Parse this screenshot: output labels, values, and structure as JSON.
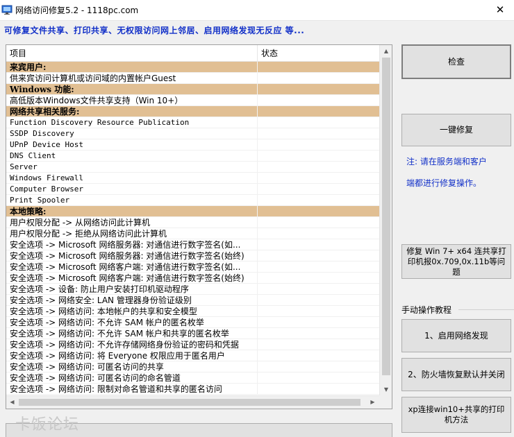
{
  "window": {
    "title": "网络访问修复5.2 - 1118pc.com",
    "close_glyph": "✕"
  },
  "subtitle": "可修复文件共享、打印共享、无权限访问网上邻居、启用网络发现无反应  等...",
  "list": {
    "columns": [
      "项目",
      "状态"
    ],
    "rows": [
      {
        "type": "section",
        "text": "来宾用户:"
      },
      {
        "type": "item",
        "text": "供来宾访问计算机或访问域的内置帐户Guest"
      },
      {
        "type": "section",
        "text": "Windows 功能:"
      },
      {
        "type": "item",
        "text": "高低版本Windows文件共享支持（Win 10+）"
      },
      {
        "type": "section",
        "text": "网络共享相关服务:"
      },
      {
        "type": "item",
        "text": "Function Discovery Resource Publication",
        "mono": true
      },
      {
        "type": "item",
        "text": "SSDP Discovery",
        "mono": true
      },
      {
        "type": "item",
        "text": "UPnP Device Host",
        "mono": true
      },
      {
        "type": "item",
        "text": "DNS Client",
        "mono": true
      },
      {
        "type": "item",
        "text": "Server",
        "mono": true
      },
      {
        "type": "item",
        "text": "Windows Firewall",
        "mono": true
      },
      {
        "type": "item",
        "text": "Computer Browser",
        "mono": true
      },
      {
        "type": "item",
        "text": "Print Spooler",
        "mono": true
      },
      {
        "type": "section",
        "text": "本地策略:"
      },
      {
        "type": "item",
        "text": "用户权限分配 -> 从网络访问此计算机"
      },
      {
        "type": "item",
        "text": "用户权限分配 -> 拒绝从网络访问此计算机"
      },
      {
        "type": "item",
        "text": "安全选项 -> Microsoft 网络服务器: 对通信进行数字签名(如..."
      },
      {
        "type": "item",
        "text": "安全选项 -> Microsoft 网络服务器: 对通信进行数字签名(始终)"
      },
      {
        "type": "item",
        "text": "安全选项 -> Microsoft 网络客户端: 对通信进行数字签名(如..."
      },
      {
        "type": "item",
        "text": "安全选项 -> Microsoft 网络客户端: 对通信进行数字签名(始终)"
      },
      {
        "type": "item",
        "text": "安全选项 -> 设备: 防止用户安装打印机驱动程序"
      },
      {
        "type": "item",
        "text": "安全选项 -> 网络安全: LAN 管理器身份验证级别"
      },
      {
        "type": "item",
        "text": "安全选项 -> 网络访问: 本地帐户的共享和安全模型"
      },
      {
        "type": "item",
        "text": "安全选项 -> 网络访问: 不允许 SAM 帐户的匿名枚举"
      },
      {
        "type": "item",
        "text": "安全选项 -> 网络访问: 不允许 SAM 帐户和共享的匿名枚举"
      },
      {
        "type": "item",
        "text": "安全选项 -> 网络访问: 不允许存储网络身份验证的密码和凭据"
      },
      {
        "type": "item",
        "text": "安全选项 -> 网络访问: 将 Everyone 权限应用于匿名用户"
      },
      {
        "type": "item",
        "text": "安全选项 -> 网络访问: 可匿名访问的共享"
      },
      {
        "type": "item",
        "text": "安全选项 -> 网络访问: 可匿名访问的命名管道"
      },
      {
        "type": "item",
        "text": "安全选项 -> 网络访问: 限制对命名管道和共享的匿名访问"
      }
    ]
  },
  "buttons": {
    "check": "检查",
    "one_click_fix": "一键修复",
    "fix_printer": "修复 Win 7+ x64 连共享打印机报0x.709,0x.11b等问题",
    "enable_discovery": "1、启用网络发现",
    "firewall_restore": "2、防火墙恢复默认并关闭",
    "xp_connect": "xp连接win10+共享的打印机方法"
  },
  "notes": {
    "line1": "注: 请在服务端和客户",
    "line2": "端都进行修复操作。"
  },
  "manual_group_label": "手动操作教程",
  "watermark": "卡饭论坛",
  "colors": {
    "section_bg": "#e1bf93",
    "accent_blue": "#1230c8"
  }
}
